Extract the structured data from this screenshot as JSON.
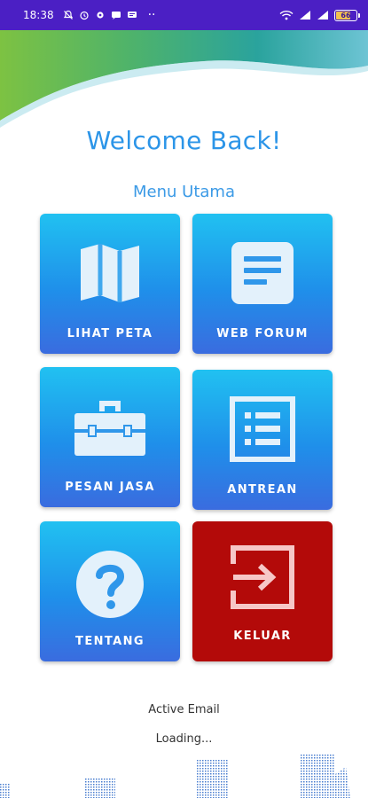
{
  "status_bar": {
    "time": "18:38",
    "dots": "··",
    "battery": "66"
  },
  "header": {
    "welcome": "Welcome Back!",
    "menu_title": "Menu Utama"
  },
  "menu": {
    "lihat_peta": "LIHAT PETA",
    "web_forum": "WEB FORUM",
    "pesan_jasa": "PESAN JASA",
    "antrean": "ANTREAN",
    "tentang": "TENTANG",
    "keluar": "KELUAR"
  },
  "footer": {
    "active_email": "Active Email",
    "loading": "Loading..."
  },
  "colors": {
    "accent_blue": "#2c95e8",
    "tile_gradient_top": "#21c1f1",
    "tile_gradient_bottom": "#3a6cdf",
    "logout_red": "#b30a09",
    "status_bar": "#4b1fc4"
  },
  "icons": {
    "lihat_peta": "map-icon",
    "web_forum": "document-icon",
    "pesan_jasa": "toolbox-icon",
    "antrean": "list-icon",
    "tentang": "help-icon",
    "keluar": "logout-icon"
  }
}
